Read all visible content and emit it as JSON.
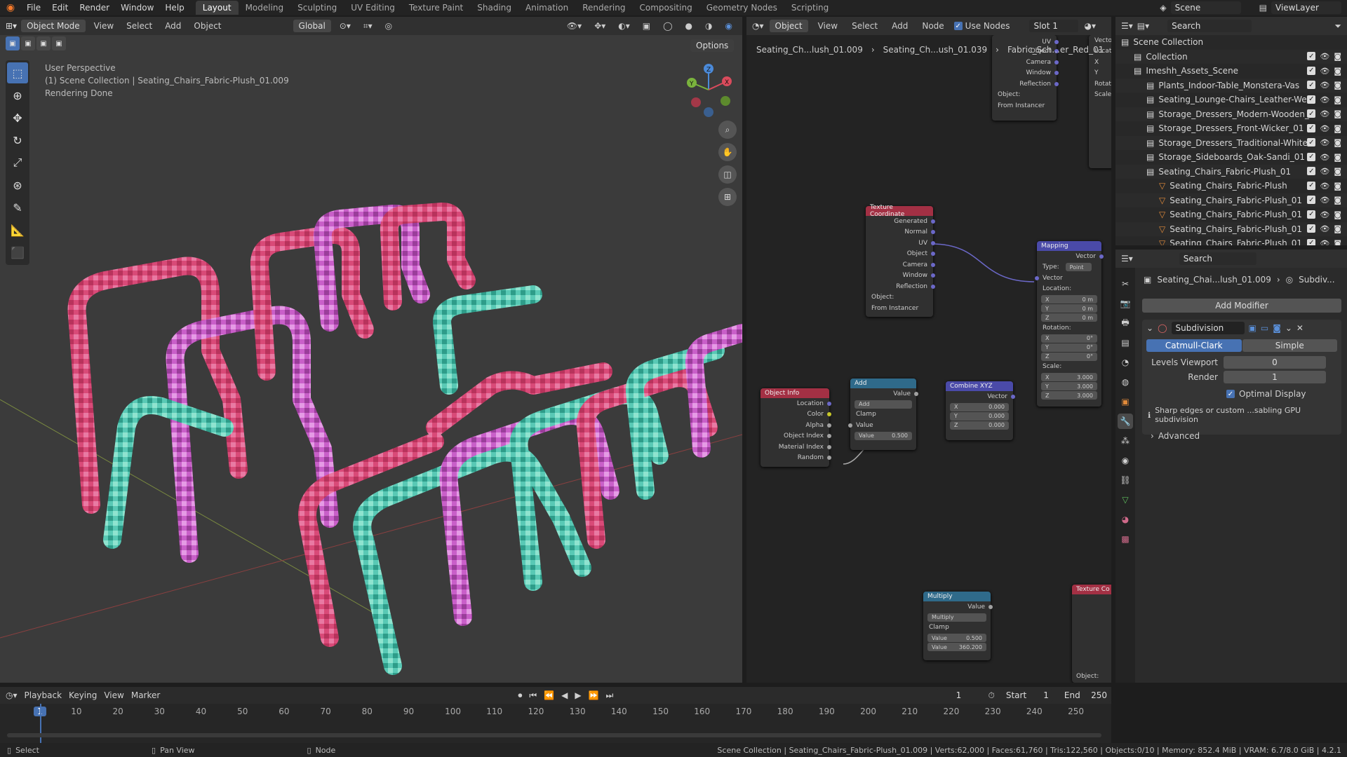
{
  "topbar": {
    "menus": [
      "File",
      "Edit",
      "Render",
      "Window",
      "Help"
    ],
    "tabs": [
      "Layout",
      "Modeling",
      "Sculpting",
      "UV Editing",
      "Texture Paint",
      "Shading",
      "Animation",
      "Rendering",
      "Compositing",
      "Geometry Nodes",
      "Scripting"
    ],
    "active_tab": "Layout",
    "scene": "Scene",
    "view_layer": "ViewLayer"
  },
  "viewport": {
    "mode": "Object Mode",
    "menu": [
      "View",
      "Select",
      "Add",
      "Object"
    ],
    "transform": "Global",
    "options": "Options",
    "overlay_lines": [
      "User Perspective",
      "(1) Scene Collection | Seating_Chairs_Fabric-Plush_01.009",
      "Rendering Done"
    ],
    "gizmo": {
      "x": "X",
      "y": "Y",
      "z": "Z"
    }
  },
  "node_editor": {
    "type": "Object",
    "menu": [
      "View",
      "Select",
      "Add",
      "Node"
    ],
    "use_nodes": "Use Nodes",
    "slot": "Slot 1",
    "breadcrumb": [
      "Seating_Ch...lush_01.009",
      "Seating_Ch...ush_01.039",
      "Fabric_Sch...er_Red_01"
    ],
    "texcoord": {
      "title": "Texture Coordinate",
      "outputs": [
        "Generated",
        "Normal",
        "UV",
        "Object",
        "Camera",
        "Window",
        "Reflection"
      ],
      "object_label": "Object:",
      "from_instancer": "From Instancer"
    },
    "texcoord_top": {
      "outputs": [
        "UV",
        "Object",
        "Camera",
        "Window",
        "Reflection"
      ],
      "object_label": "Object:",
      "from_instancer": "From Instancer"
    },
    "mapping": {
      "title": "Mapping",
      "output": "Vector",
      "type_label": "Type:",
      "type": "Point",
      "vector": "Vector",
      "location": "Location:",
      "loc": [
        [
          "X",
          "0 m"
        ],
        [
          "Y",
          "0 m"
        ],
        [
          "Z",
          "0 m"
        ]
      ],
      "rotation": "Rotation:",
      "rot": [
        [
          "X",
          "0°"
        ],
        [
          "Y",
          "0°"
        ],
        [
          "Z",
          "0°"
        ]
      ],
      "scale": "Scale:",
      "scl": [
        [
          "X",
          "3.000"
        ],
        [
          "Y",
          "3.000"
        ],
        [
          "Z",
          "3.000"
        ]
      ]
    },
    "object_info": {
      "title": "Object Info",
      "outputs": [
        "Location",
        "Color",
        "Alpha",
        "Object Index",
        "Material Index",
        "Random"
      ]
    },
    "add": {
      "title": "Add",
      "output": "Value",
      "op": "Add",
      "clamp": "Clamp",
      "input": "Value",
      "value_label": "Value",
      "value": "0.500"
    },
    "combine": {
      "title": "Combine XYZ",
      "output": "Vector",
      "x": "0.000",
      "y": "0.000",
      "z": "0.000"
    },
    "multiply": {
      "title": "Multiply",
      "output": "Value",
      "op": "Multiply",
      "clamp": "Clamp",
      "v1_label": "Value",
      "v1": "0.500",
      "v2_label": "Value",
      "v2": "360.200"
    },
    "texcoord2": {
      "title": "Texture Co",
      "object_label": "Object:"
    },
    "side_partial": {
      "vector": "Vector",
      "location": "Locatio",
      "rotation": "Rotation",
      "scale": "Scale:",
      "xyz": [
        "X",
        "Y",
        "Z"
      ]
    }
  },
  "outliner": {
    "search": "Search",
    "rows": [
      {
        "label": "Scene Collection",
        "indent": 0
      },
      {
        "label": "Collection",
        "indent": 1
      },
      {
        "label": "Imeshh_Assets_Scene",
        "indent": 1
      },
      {
        "label": "Plants_Indoor-Table_Monstera-Vas",
        "indent": 2
      },
      {
        "label": "Seating_Lounge-Chairs_Leather-We",
        "indent": 2
      },
      {
        "label": "Storage_Dressers_Modern-Wooden_",
        "indent": 2
      },
      {
        "label": "Storage_Dressers_Front-Wicker_01",
        "indent": 2
      },
      {
        "label": "Storage_Dressers_Traditional-White",
        "indent": 2
      },
      {
        "label": "Storage_Sideboards_Oak-Sandi_01",
        "indent": 2
      },
      {
        "label": "Seating_Chairs_Fabric-Plush_01",
        "indent": 2
      },
      {
        "label": "Seating_Chairs_Fabric-Plush",
        "indent": 3
      },
      {
        "label": "Seating_Chairs_Fabric-Plush_01",
        "indent": 3
      },
      {
        "label": "Seating_Chairs_Fabric-Plush_01",
        "indent": 3
      },
      {
        "label": "Seating_Chairs_Fabric-Plush_01",
        "indent": 3
      },
      {
        "label": "Seating_Chairs_Fabric-Plush_01",
        "indent": 3
      }
    ]
  },
  "properties": {
    "search": "Search",
    "breadcrumb": "Seating_Chai...lush_01.009",
    "modifier_crumb": "Subdiv...",
    "add_modifier": "Add Modifier",
    "modifier_name": "Subdivision",
    "catmull": "Catmull-Clark",
    "simple": "Simple",
    "levels_label": "Levels Viewport",
    "levels": "0",
    "render_label": "Render",
    "render": "1",
    "optimal": "Optimal Display",
    "warning": "Sharp edges or custom ...sabling GPU subdivision",
    "advanced": "Advanced"
  },
  "timeline": {
    "menu": [
      "Playback",
      "Keying",
      "View",
      "Marker"
    ],
    "current": "1",
    "start_label": "Start",
    "start": "1",
    "end_label": "End",
    "end": "250",
    "ticks": [
      "1",
      "10",
      "20",
      "30",
      "40",
      "50",
      "60",
      "70",
      "80",
      "90",
      "100",
      "110",
      "120",
      "130",
      "140",
      "150",
      "160",
      "170",
      "180",
      "190",
      "200",
      "210",
      "220",
      "230",
      "240",
      "250"
    ]
  },
  "status": {
    "select": "Select",
    "pan": "Pan View",
    "node": "Node",
    "info": "Scene Collection | Seating_Chairs_Fabric-Plush_01.009 | Verts:62,000 | Faces:61,760 | Tris:122,560 | Objects:0/10 | Memory: 852.4 MiB | VRAM: 6.7/8.0 GiB | 4.2.1"
  }
}
